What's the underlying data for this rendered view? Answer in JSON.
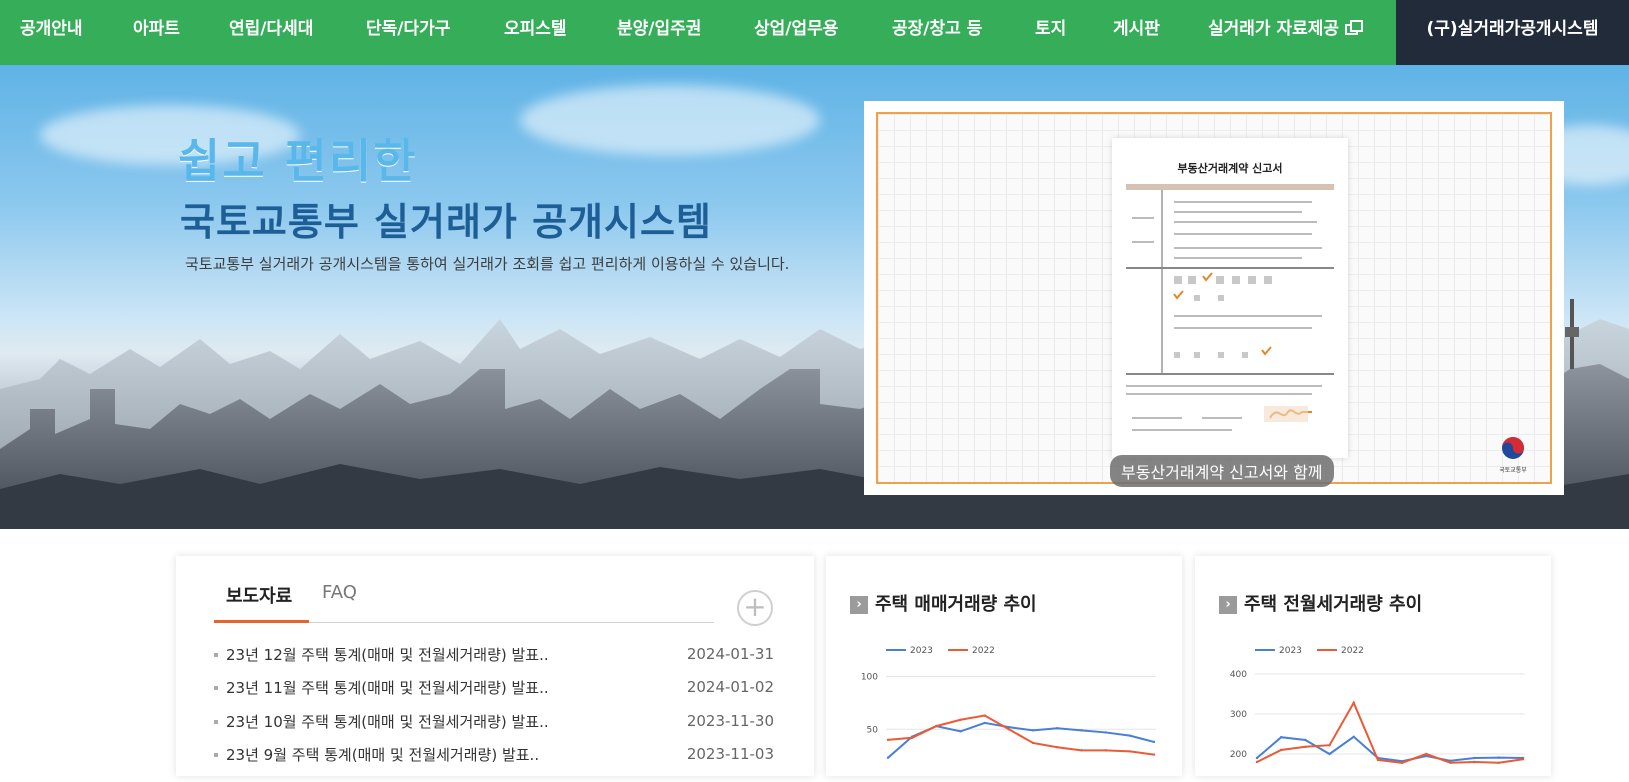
{
  "nav": {
    "items": [
      {
        "label": "공개안내"
      },
      {
        "label": "아파트"
      },
      {
        "label": "연립/다세대"
      },
      {
        "label": "단독/다가구"
      },
      {
        "label": "오피스텔"
      },
      {
        "label": "분양/입주권"
      },
      {
        "label": "상업/업무용"
      },
      {
        "label": "공장/창고 등"
      },
      {
        "label": "토지"
      },
      {
        "label": "게시판"
      },
      {
        "label": "실거래가 자료제공",
        "icon": "external-link-icon"
      }
    ],
    "old_system": "(구)실거래가공개시스템",
    "colors": {
      "nav_bg": "#35ad59",
      "old_bg": "#222b3a"
    }
  },
  "hero": {
    "title_line1": "쉽고 편리한",
    "title_line2": "국토교통부 실거래가 공개시스템",
    "description": "국토교통부 실거래가 공개시스템을 통하여 실거래가 조회를 쉽고 편리하게 이용하실 수 있습니다.",
    "video": {
      "doc_title": "부동산거래계약 신고서",
      "caption": "부동산거래계약 신고서와 함께",
      "logo_text": "국토교통부"
    }
  },
  "news": {
    "tabs": [
      {
        "label": "보도자료",
        "active": true
      },
      {
        "label": "FAQ",
        "active": false
      }
    ],
    "more_icon": "plus-circle-icon",
    "items": [
      {
        "title": "23년 12월 주택 통계(매매 및 전월세거래량) 발표..",
        "date": "2024-01-31"
      },
      {
        "title": "23년 11월 주택 통계(매매 및 전월세거래량) 발표..",
        "date": "2024-01-02"
      },
      {
        "title": "23년 10월 주택 통계(매매 및 전월세거래량) 발표..",
        "date": "2023-11-30"
      },
      {
        "title": "23년 9월 주택 통계(매매 및 전월세거래량) 발표..",
        "date": "2023-11-03"
      }
    ]
  },
  "chart_data": [
    {
      "type": "line",
      "title": "주택 매매거래량 추이",
      "legend_position": "top-left",
      "y_ticks": [
        50,
        100
      ],
      "ylim": [
        0,
        110
      ],
      "grid": true,
      "series": [
        {
          "name": "2023",
          "color": "#4a7fd8",
          "values": [
            23,
            43,
            53,
            48,
            56,
            52,
            49,
            51,
            49,
            47,
            44,
            38
          ]
        },
        {
          "name": "2022",
          "color": "#ea5a34",
          "values": [
            40,
            42,
            53,
            59,
            63,
            50,
            37,
            33,
            30,
            30,
            29,
            26
          ]
        }
      ]
    },
    {
      "type": "line",
      "title": "주택 전월세거래량 추이",
      "legend_position": "top-left",
      "y_ticks": [
        200,
        300,
        400
      ],
      "ylim": [
        130,
        420
      ],
      "grid": true,
      "series": [
        {
          "name": "2023",
          "color": "#4a7fd8",
          "values": [
            190,
            242,
            235,
            200,
            243,
            190,
            182,
            195,
            183,
            190,
            191,
            190
          ]
        },
        {
          "name": "2022",
          "color": "#ea5a34",
          "values": [
            180,
            210,
            218,
            222,
            328,
            185,
            178,
            200,
            178,
            180,
            178,
            187
          ]
        }
      ]
    }
  ]
}
